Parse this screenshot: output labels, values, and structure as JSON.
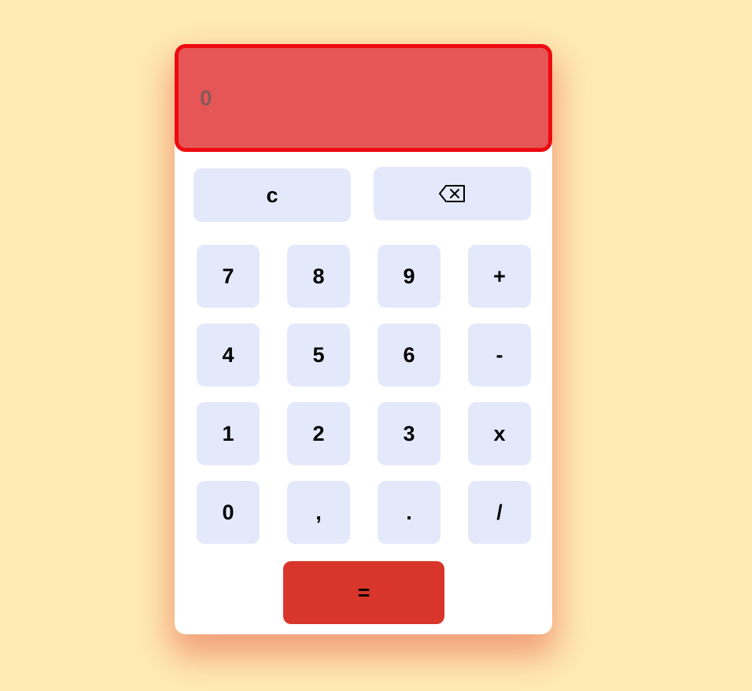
{
  "display": {
    "value": "0"
  },
  "controls": {
    "clear": "c"
  },
  "keys": {
    "row1": [
      "7",
      "8",
      "9",
      "+"
    ],
    "row2": [
      "4",
      "5",
      "6",
      "-"
    ],
    "row3": [
      "1",
      "2",
      "3",
      "x"
    ],
    "row4": [
      "0",
      ",",
      ".",
      "/"
    ]
  },
  "equals": "=",
  "icons": {
    "backspace": "backspace-icon"
  },
  "colors": {
    "background": "#ffebb4",
    "display": "#e65656",
    "display_border": "#ee0a10",
    "key": "#e3e9fa",
    "equals": "#d9362b"
  }
}
